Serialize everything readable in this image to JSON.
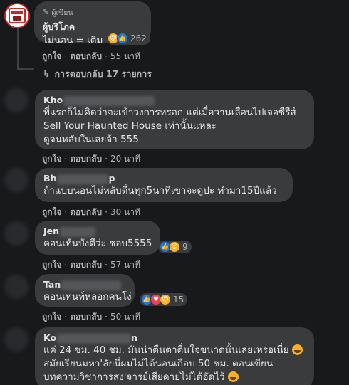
{
  "colors": {
    "background": "#18191a",
    "bubble": "#3a3b3c",
    "text": "#e4e6eb",
    "muted": "#b0b3b8",
    "like": "#1877f2",
    "haha": "#f7b125",
    "love": "#f33e58"
  },
  "reply": {
    "badge": "ผู้เขียน",
    "author": "ผู้บริโภค",
    "text": "ไม่นอน = เติม",
    "reaction_count": "262",
    "like_label": "ถูกใจ",
    "reply_label": "ตอบกลับ",
    "time": "55 นาที",
    "view_replies": "การตอบกลับ 17 รายการ"
  },
  "comments": [
    {
      "author": "Kho",
      "lines": [
        "ที่แรกก็ไม่คิดว่าจะเข้าวงการหรอก แต่เมื่อวานเลื่อนไปเจอซีรีส์",
        "Sell Your Haunted House เท่านั้นแหละ",
        "ดูจนหลับในเลยจ้า 555"
      ],
      "like_label": "ถูกใจ",
      "reply_label": "ตอบกลับ",
      "time": "20 นาที"
    },
    {
      "author": "Bh",
      "author_tail": "p",
      "lines": [
        "ถ้าแบบนอนไม่หลับตื่นทุก5นาทีเขาจะดูปะ ทำมา15ปีแล้ว"
      ],
      "like_label": "ถูกใจ",
      "reply_label": "ตอบกลับ",
      "time": "30 นาที"
    },
    {
      "author": "Jen",
      "lines": [
        "คอนเท้นบังตีว่ะ ชอบ5555"
      ],
      "reaction_count": "9",
      "like_label": "ถูกใจ",
      "reply_label": "ตอบกลับ",
      "time": "57 นาที"
    },
    {
      "author": "Tan",
      "lines": [
        "คอนเทนท์หลอกคนโง่"
      ],
      "reaction_count": "15",
      "like_label": "ถูกใจ",
      "reply_label": "ตอบกลับ",
      "time": "50 นาที"
    },
    {
      "author": "Ko",
      "author_tail": "n",
      "lines": [
        "แค่ 24 ชม. 40 ชม. มันน่าตื่นตาตื่นใจขนาดนั้นเลยเหรอเนี่ย",
        "สมัยเรียนมหา'ลัยนี่ผมไม่ได้นอนเกือบ 50 ชม. ตอนเขียน",
        "บทความวิชาการส่ง'จารย์เสียดายไม่ได้อัดไว้"
      ]
    }
  ],
  "separator": "·"
}
